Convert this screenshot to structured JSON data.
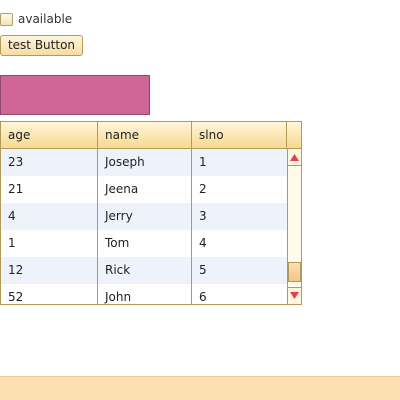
{
  "checkbox": {
    "label": "available",
    "checked": false
  },
  "button": {
    "label": "test Button"
  },
  "panel": {
    "color": "#d06698"
  },
  "table": {
    "columns": [
      "age",
      "name",
      "slno"
    ],
    "rows": [
      {
        "age": "23",
        "name": "Joseph",
        "slno": "1"
      },
      {
        "age": "21",
        "name": "Jeena",
        "slno": "2"
      },
      {
        "age": "4",
        "name": "Jerry",
        "slno": "3"
      },
      {
        "age": "1",
        "name": "Tom",
        "slno": "4"
      },
      {
        "age": "12",
        "name": "Rick",
        "slno": "5"
      },
      {
        "age": "52",
        "name": "John",
        "slno": "6"
      }
    ],
    "scroll_position": 0.95
  },
  "icons": {
    "scroll_up": "arrow-up-icon",
    "scroll_down": "arrow-down-icon"
  },
  "colors": {
    "accent": "#f7d98f",
    "row_alt": "#eef3fb",
    "border": "#b39a58",
    "arrow": "#e0405a",
    "footer": "#fde0b1"
  }
}
